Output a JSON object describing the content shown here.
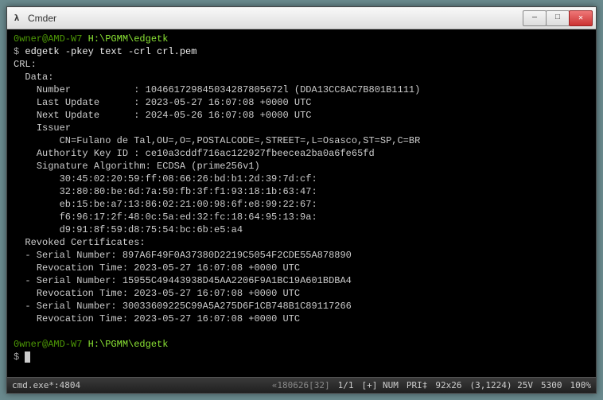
{
  "window": {
    "title": "Cmder",
    "icon_label": "λ"
  },
  "prompt": {
    "user_host": "0wner@AMD-W7",
    "path": "H:\\PGMM\\edgetk",
    "symbol": "$",
    "command": "edgetk -pkey text -crl crl.pem"
  },
  "crl": {
    "header": "CRL:",
    "data_header": "Data:",
    "number_label": "Number",
    "number_value": "104661729845034287805672l (DDA13CC8AC7B801B1111)",
    "last_update_label": "Last Update",
    "last_update_value": "2023-05-27 16:07:08 +0000 UTC",
    "next_update_label": "Next Update",
    "next_update_value": "2024-05-26 16:07:08 +0000 UTC",
    "issuer_label": "Issuer",
    "issuer_value": "CN=Fulano de Tal,OU=,O=,POSTALCODE=,STREET=,L=Osasco,ST=SP,C=BR",
    "authority_key_id_label": "Authority Key ID",
    "authority_key_id_value": "ce10a3cddf716ac122927fbeecea2ba0a6fe65fd",
    "sig_alg_label": "Signature Algorithm:",
    "sig_alg_value": "ECDSA (prime256v1)",
    "sig_lines": [
      "30:45:02:20:59:ff:08:66:26:bd:b1:2d:39:7d:cf:",
      "32:80:80:be:6d:7a:59:fb:3f:f1:93:18:1b:63:47:",
      "eb:15:be:a7:13:86:02:21:00:98:6f:e8:99:22:67:",
      "f6:96:17:2f:48:0c:5a:ed:32:fc:18:64:95:13:9a:",
      "d9:91:8f:59:d8:75:54:bc:6b:e5:a4"
    ],
    "revoked_header": "Revoked Certificates:",
    "revoked": [
      {
        "serial_label": "- Serial Number:",
        "serial": "897A6F49F0A37380D2219C5054F2CDE55A878890",
        "time_label": "Revocation Time:",
        "time": "2023-05-27 16:07:08 +0000 UTC"
      },
      {
        "serial_label": "- Serial Number:",
        "serial": "15955C49443938D45AA2206F9A1BC19A601BDBA4",
        "time_label": "Revocation Time:",
        "time": "2023-05-27 16:07:08 +0000 UTC"
      },
      {
        "serial_label": "- Serial Number:",
        "serial": "30033609225C99A5A275D6F1CB748B1C89117266",
        "time_label": "Revocation Time:",
        "time": "2023-05-27 16:07:08 +0000 UTC"
      }
    ]
  },
  "statusbar": {
    "tab": "cmd.exe*:4804",
    "seg1": "«180626[32]",
    "seg2": "1/1",
    "seg3": "[+] NUM",
    "seg4": "PRI‡",
    "seg5": "92x26",
    "seg6": "(3,1224) 25V",
    "seg7": "5300",
    "seg8": "100%"
  }
}
